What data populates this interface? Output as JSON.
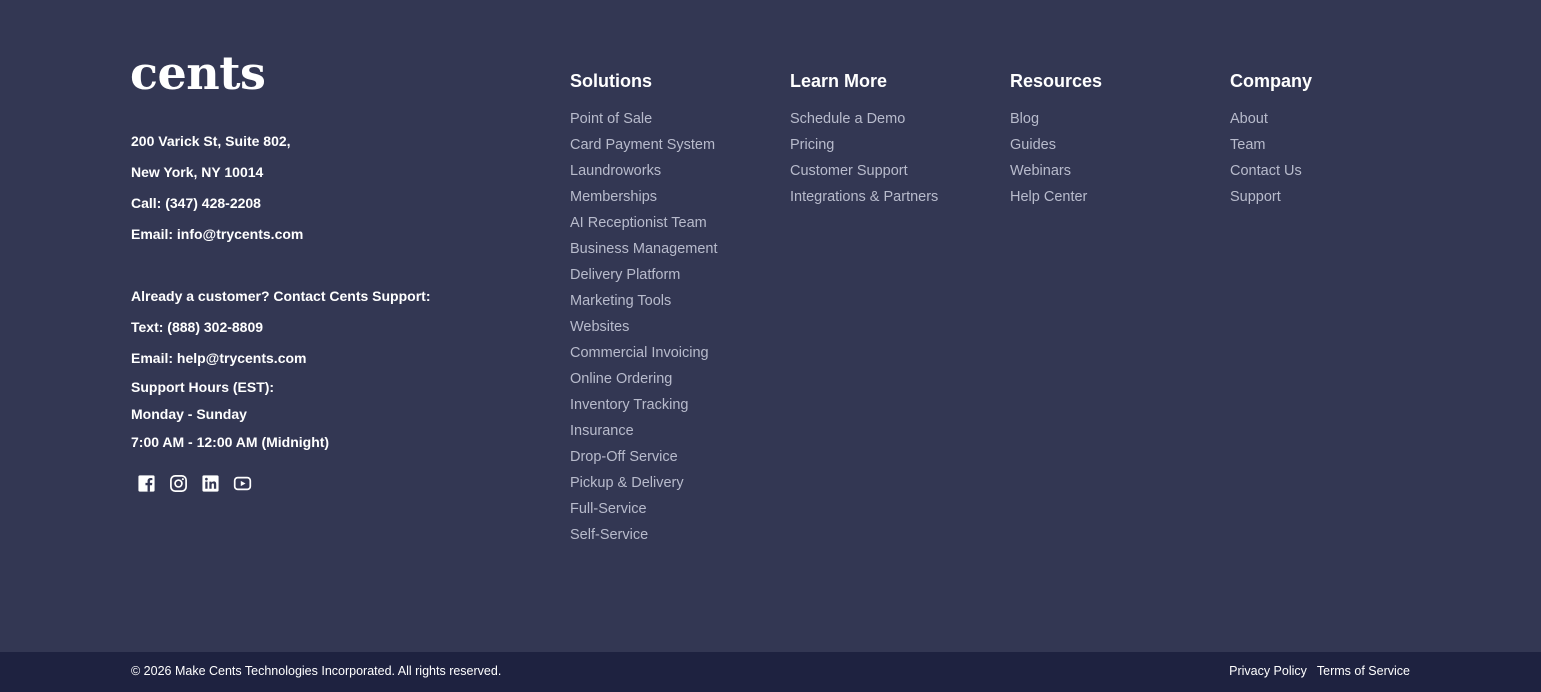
{
  "brand": {
    "logo_text": "cents"
  },
  "contact": {
    "address_line1": "200 Varick St, Suite 802,",
    "address_line2": "New York, NY 10014",
    "call": "Call: (347) 428-2208",
    "email": "Email: info@trycents.com",
    "support_heading": "Already a customer? Contact Cents Support:",
    "support_text": "Text: (888) 302-8809",
    "support_email": "Email: help@trycents.com",
    "hours_label": "Support Hours (EST):",
    "hours_days": "Monday - Sunday",
    "hours_time": "7:00 AM - 12:00 AM (Midnight)"
  },
  "social": [
    "facebook-icon",
    "instagram-icon",
    "linkedin-icon",
    "youtube-icon"
  ],
  "columns": {
    "solutions": {
      "title": "Solutions",
      "items": [
        "Point of Sale",
        "Card Payment System",
        "Laundroworks",
        "Memberships",
        "AI Receptionist Team",
        "Business Management",
        "Delivery Platform",
        "Marketing Tools",
        "Websites",
        "Commercial Invoicing",
        "Online Ordering",
        "Inventory Tracking",
        "Insurance",
        "Drop-Off Service",
        "Pickup & Delivery",
        "Full-Service",
        "Self-Service"
      ]
    },
    "learn_more": {
      "title": "Learn More",
      "items": [
        "Schedule a Demo",
        "Pricing",
        "Customer Support",
        "Integrations & Partners"
      ]
    },
    "resources": {
      "title": "Resources",
      "items": [
        "Blog",
        "Guides",
        "Webinars",
        "Help Center"
      ]
    },
    "company": {
      "title": "Company",
      "items": [
        "About",
        "Team",
        "Contact Us",
        "Support"
      ]
    }
  },
  "bottom_bar": {
    "copyright": "© 2026 Make Cents Technologies Incorporated. All rights reserved.",
    "privacy": "Privacy Policy",
    "terms": "Terms of Service"
  },
  "colors": {
    "background": "#333753",
    "bottom_bar": "#1e2240",
    "link": "#b8bbcc",
    "heading": "#ffffff"
  }
}
